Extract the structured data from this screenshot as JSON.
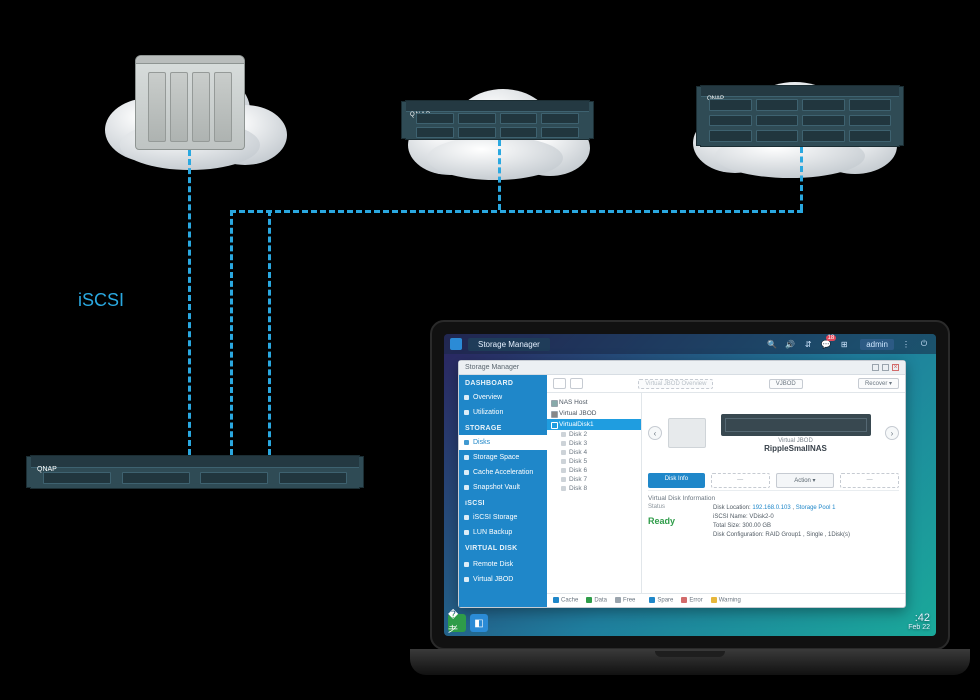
{
  "protocol_label": "iSCSI",
  "brand": "QNAP",
  "os": {
    "tab": "Storage Manager",
    "user": "admin",
    "notif_count": "18",
    "time": ":42",
    "date": "Feb 22"
  },
  "window": {
    "title": "Storage Manager"
  },
  "sidebar": {
    "dashboard": "DASHBOARD",
    "overview": "Overview",
    "utilization": "Utilization",
    "storage": "STORAGE",
    "disks": "Disks",
    "storage_space": "Storage Space",
    "cache": "Cache Acceleration",
    "snapshot": "Snapshot Vault",
    "iscsi": "iSCSI",
    "iscsi_storage": "iSCSI Storage",
    "lun_backup": "LUN Backup",
    "virtual_disk_h": "VIRTUAL DISK",
    "remote_disk": "Remote Disk",
    "virtual_jbod": "Virtual JBOD"
  },
  "toolbar": {
    "vjbod_overview": "Virtual JBOD Overview",
    "vjbod": "VJBOD",
    "recover": "Recover"
  },
  "tree": {
    "nas_host": "NAS Host",
    "virtual_jbod": "Virtual JBOD",
    "vdisk_sel": "VirtualDisk1",
    "disk_prefix": "Disk"
  },
  "preview": {
    "caption1": "Virtual JBOD",
    "caption2": "RippleSmallNAS",
    "btn_info": "Disk Info",
    "btn_action": "Action",
    "nav_prev": "‹",
    "nav_next": "›"
  },
  "details": {
    "header": "Virtual Disk Information",
    "status_label": "Status",
    "status_value": "Ready",
    "loc_label": "Disk Location:",
    "loc_ip": "192.168.0.103",
    "loc_pool": "Storage Pool 1",
    "iscsi_label": "iSCSI Name: VDisk2-0",
    "size_label": "Total Size: 300.00 GB",
    "raid_label": "Disk Configuration: RAID Group1 , Single , 1Disk(s)"
  },
  "legend": {
    "cache": "Cache",
    "data": "Data",
    "free": "Free",
    "spare": "Spare",
    "error": "Error",
    "warning": "Warning"
  }
}
